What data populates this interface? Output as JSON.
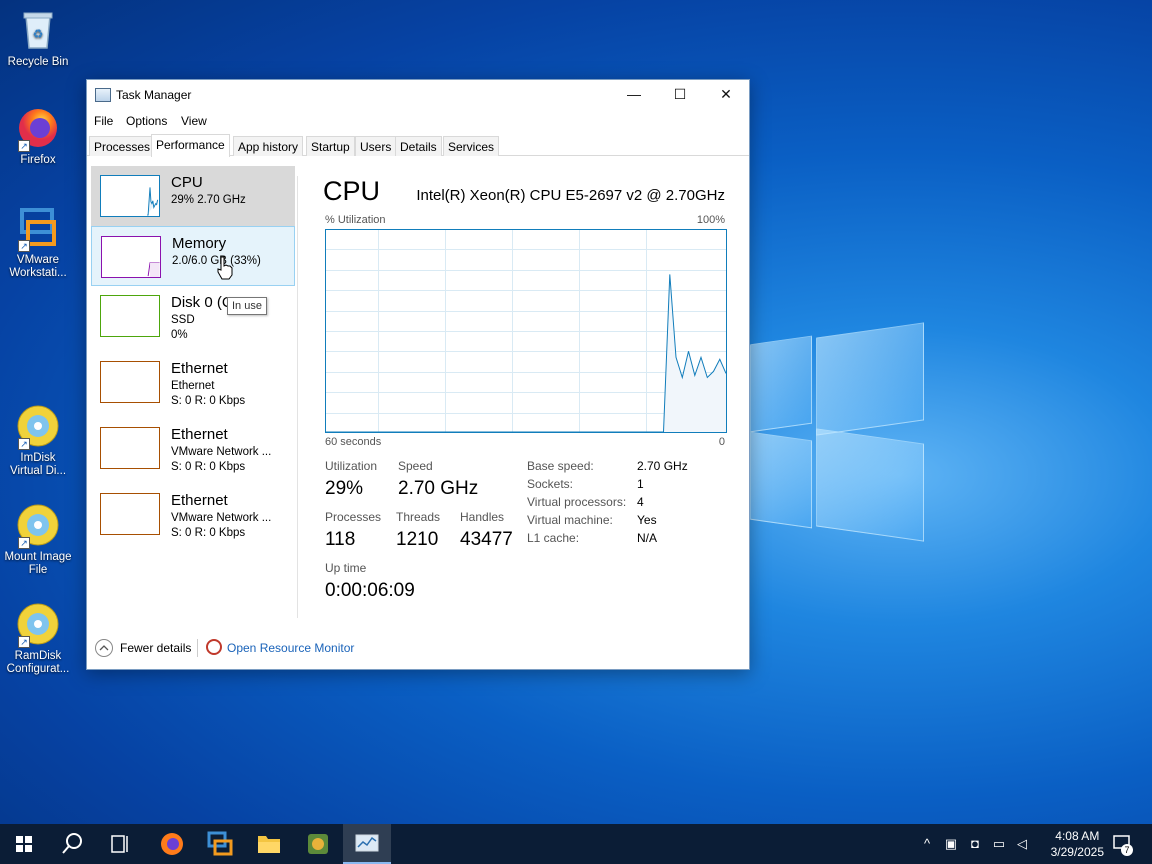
{
  "desktop": {
    "icons": [
      {
        "label": "Recycle Bin"
      },
      {
        "label": "Firefox"
      },
      {
        "label_line1": "VMware",
        "label_line2": "Workstati..."
      },
      {
        "label_line1": "ImDisk",
        "label_line2": "Virtual Di..."
      },
      {
        "label_line1": "Mount Image",
        "label_line2": "File"
      },
      {
        "label_line1": "RamDisk",
        "label_line2": "Configurat..."
      }
    ]
  },
  "window": {
    "title": "Task Manager",
    "menu": [
      "File",
      "Options",
      "View"
    ],
    "tabs": [
      "Processes",
      "Performance",
      "App history",
      "Startup",
      "Users",
      "Details",
      "Services"
    ],
    "active_tab": "Performance"
  },
  "resources": [
    {
      "name": "CPU",
      "sub1": "29%  2.70 GHz",
      "color": "#117dbb",
      "state": "selected"
    },
    {
      "name": "Memory",
      "sub1": "2.0/6.0 GB (33%)",
      "color": "#8b12ae",
      "state": "hover"
    },
    {
      "name": "Disk 0 (C",
      "sub1": "SSD",
      "sub2": "0%",
      "color": "#4da60c"
    },
    {
      "name": "Ethernet",
      "sub1": "Ethernet",
      "sub2": "S: 0  R: 0 Kbps",
      "color": "#a74f01"
    },
    {
      "name": "Ethernet",
      "sub1": "VMware Network ...",
      "sub2": "S: 0  R: 0 Kbps",
      "color": "#a74f01"
    },
    {
      "name": "Ethernet",
      "sub1": "VMware Network ...",
      "sub2": "S: 0  R: 0 Kbps",
      "color": "#a74f01"
    }
  ],
  "tooltip": "In use",
  "cpu_panel": {
    "title": "CPU",
    "model": "Intel(R) Xeon(R) CPU E5-2697 v2 @ 2.70GHz",
    "util_label": "% Utilization",
    "util_max": "100%",
    "time_label": "60 seconds",
    "time_zero": "0",
    "graph_color": "#117dbb",
    "utilization_series": [
      0,
      0,
      0,
      0,
      0,
      0,
      0,
      0,
      0,
      0,
      0,
      0,
      0,
      0,
      0,
      0,
      0,
      0,
      0,
      0,
      0,
      0,
      0,
      0,
      0,
      0,
      0,
      0,
      0,
      0,
      0,
      0,
      0,
      0,
      0,
      0,
      0,
      0,
      0,
      0,
      0,
      0,
      0,
      0,
      0,
      0,
      0,
      0,
      0,
      0,
      0,
      0,
      0,
      0,
      0,
      78,
      37,
      27,
      40,
      28,
      37,
      27,
      30,
      36,
      29
    ],
    "stats": {
      "utilization_label": "Utilization",
      "utilization": "29%",
      "speed_label": "Speed",
      "speed": "2.70 GHz",
      "processes_label": "Processes",
      "processes": "118",
      "threads_label": "Threads",
      "threads": "1210",
      "handles_label": "Handles",
      "handles": "43477",
      "uptime_label": "Up time",
      "uptime": "0:00:06:09"
    },
    "specs": [
      {
        "label": "Base speed:",
        "value": "2.70 GHz"
      },
      {
        "label": "Sockets:",
        "value": "1"
      },
      {
        "label": "Virtual processors:",
        "value": "4"
      },
      {
        "label": "Virtual machine:",
        "value": "Yes"
      },
      {
        "label": "L1 cache:",
        "value": "N/A"
      }
    ]
  },
  "footer": {
    "fewer_details": "Fewer details",
    "open_rm": "Open Resource Monitor"
  },
  "taskbar": {
    "time": "4:08 AM",
    "date": "3/29/2025",
    "notifications": "7"
  }
}
